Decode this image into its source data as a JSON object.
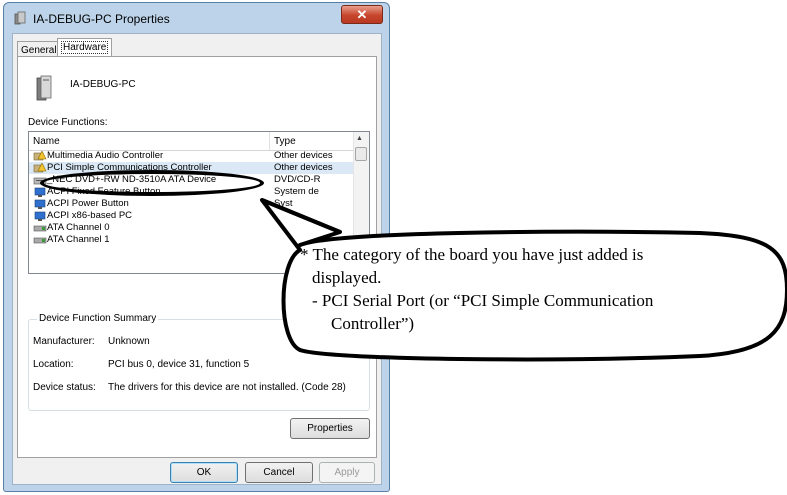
{
  "window": {
    "title": "IA-DEBUG-PC Properties",
    "close_label": "✕"
  },
  "tabs": [
    "General",
    "Hardware"
  ],
  "device": {
    "name": "IA-DEBUG-PC",
    "functions_label": "Device Functions:"
  },
  "list": {
    "columns": [
      "Name",
      "Type"
    ],
    "rows": [
      {
        "name": "Multimedia Audio Controller",
        "type": "Other devices",
        "icon": "warning-device-icon"
      },
      {
        "name": "PCI Simple Communications Controller",
        "type": "Other devices",
        "icon": "warning-device-icon"
      },
      {
        "name": "_NEC DVD+-RW ND-3510A ATA Device",
        "type": "DVD/CD-R",
        "icon": "dvd-drive-icon"
      },
      {
        "name": "ACPI Fixed Feature Button",
        "type": "System de",
        "icon": "system-device-icon"
      },
      {
        "name": "ACPI Power Button",
        "type": "Syst",
        "icon": "system-device-icon"
      },
      {
        "name": "ACPI x86-based PC",
        "type": "",
        "icon": "computer-icon"
      },
      {
        "name": "ATA Channel 0",
        "type": "",
        "icon": "ide-controller-icon"
      },
      {
        "name": "ATA Channel 1",
        "type": "",
        "icon": "ide-controller-icon"
      }
    ],
    "selected_index": 1
  },
  "summary": {
    "title": "Device Function Summary",
    "manufacturer_label": "Manufacturer:",
    "manufacturer": "Unknown",
    "location_label": "Location:",
    "location": "PCI bus 0, device 31, function 5",
    "status_label": "Device status:",
    "status": "The drivers for this device are not installed. (Code 28)"
  },
  "buttons": {
    "properties": "Properties",
    "ok": "OK",
    "cancel": "Cancel",
    "apply": "Apply"
  },
  "callout": {
    "line1": "* The category of the board you have just added is",
    "line2": "displayed.",
    "line3": "- PCI Serial Port (or “PCI Simple Communication",
    "line4": "Controller”)"
  },
  "colors": {
    "title_bar": "#bcd3e9",
    "selection": "#dbe9f6",
    "close_button": "#c7452b"
  }
}
